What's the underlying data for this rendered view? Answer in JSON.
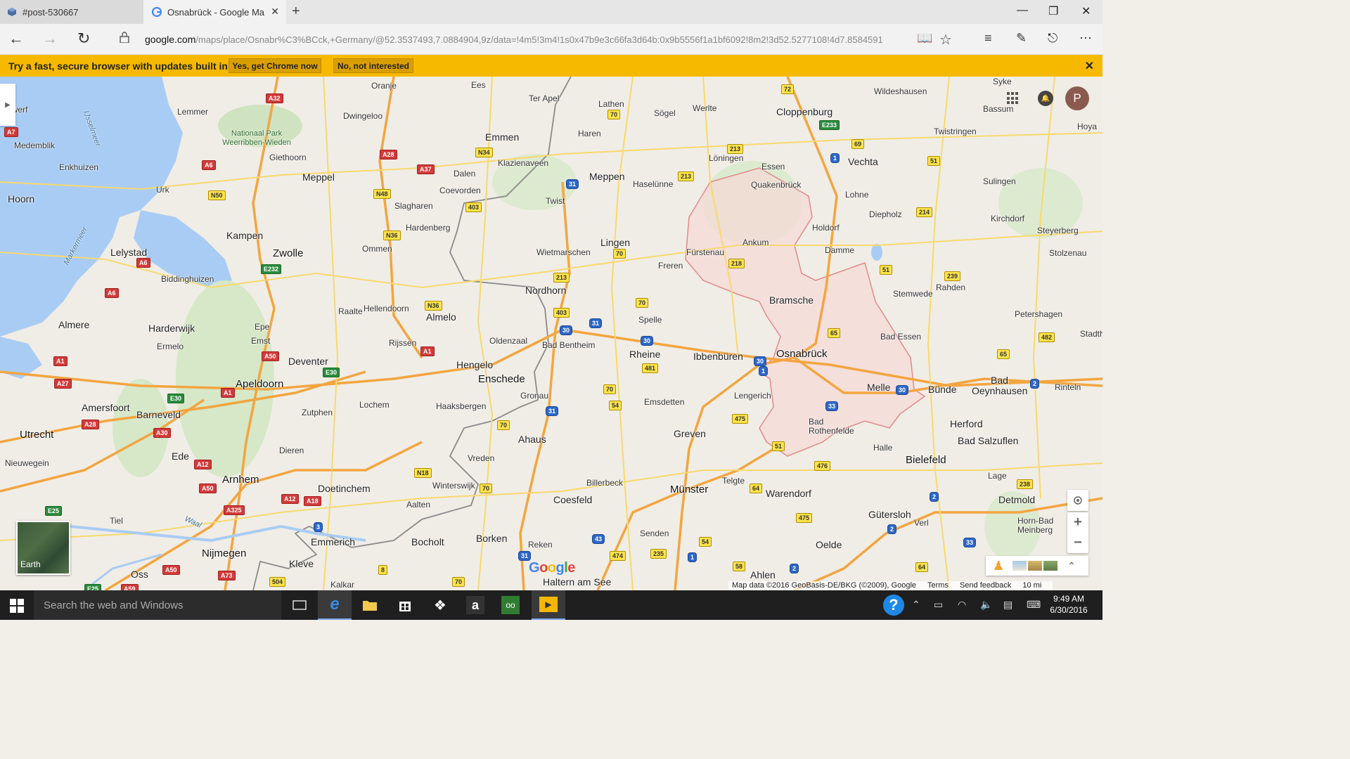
{
  "browser": {
    "tabs": [
      {
        "label": "#post-530667",
        "active": false
      },
      {
        "label": "Osnabrück - Google Ma",
        "active": true
      }
    ],
    "url_host": "google.com",
    "url_path": "/maps/place/Osnabr%C3%BCck,+Germany/@52.3537493,7.0884904,9z/data=!4m5!3m4!1s0x47b9e3c66fa3d64b:0x9b5556f1a1bf6092!8m2!3d52.5277108!4d7.8584591"
  },
  "promo": {
    "text": "Try a fast, secure browser with updates built in",
    "accept_label": "Yes, get Chrome now",
    "decline_label": "No, not interested"
  },
  "map": {
    "user_initial": "P",
    "earth_label": "Earth",
    "google_logo": "Google",
    "attribution": "Map data ©2016 GeoBasis-DE/BKG (©2009), Google",
    "terms": "Terms",
    "feedback": "Send feedback",
    "scale": "10 mi",
    "places": [
      {
        "name": "Oranje",
        "cls": "place"
      },
      {
        "name": "Ees",
        "cls": "place"
      },
      {
        "name": "Ter Apel",
        "cls": "place"
      },
      {
        "name": "Lathen",
        "cls": "place"
      },
      {
        "name": "Sögel",
        "cls": "place"
      },
      {
        "name": "Werlte",
        "cls": "place"
      },
      {
        "name": "Cloppenburg",
        "cls": "place big"
      },
      {
        "name": "Wildeshausen",
        "cls": "place"
      },
      {
        "name": "Syke",
        "cls": "place"
      },
      {
        "name": "Bassum",
        "cls": "place"
      },
      {
        "name": "erwerf",
        "cls": "place"
      },
      {
        "name": "Lemmer",
        "cls": "place"
      },
      {
        "name": "Dwingeloo",
        "cls": "place"
      },
      {
        "name": "Haren",
        "cls": "place"
      },
      {
        "name": "Emmen",
        "cls": "place big"
      },
      {
        "name": "Twistringen",
        "cls": "place"
      },
      {
        "name": "Hoya",
        "cls": "place"
      },
      {
        "name": "Medemblik",
        "cls": "place"
      },
      {
        "name": "Nationaal Park Weerribben-Wieden",
        "cls": "place park"
      },
      {
        "name": "Giethoorn",
        "cls": "place"
      },
      {
        "name": "Klazienaveen",
        "cls": "place"
      },
      {
        "name": "Löningen",
        "cls": "place"
      },
      {
        "name": "Vechta",
        "cls": "place big"
      },
      {
        "name": "Enkhuizen",
        "cls": "place"
      },
      {
        "name": "IJsselmeer",
        "cls": "place water"
      },
      {
        "name": "Meppel",
        "cls": "place big"
      },
      {
        "name": "Dalen",
        "cls": "place"
      },
      {
        "name": "Meppen",
        "cls": "place big"
      },
      {
        "name": "Haselünne",
        "cls": "place"
      },
      {
        "name": "Essen",
        "cls": "place"
      },
      {
        "name": "Quakenbrück",
        "cls": "place"
      },
      {
        "name": "Urk",
        "cls": "place"
      },
      {
        "name": "Coevorden",
        "cls": "place"
      },
      {
        "name": "Sulingen",
        "cls": "place"
      },
      {
        "name": "Hoorn",
        "cls": "place big"
      },
      {
        "name": "Lohne",
        "cls": "place"
      },
      {
        "name": "Twist",
        "cls": "place"
      },
      {
        "name": "Slagharen",
        "cls": "place"
      },
      {
        "name": "Diepholz",
        "cls": "place"
      },
      {
        "name": "Kirchdorf",
        "cls": "place"
      },
      {
        "name": "Hardenberg",
        "cls": "place"
      },
      {
        "name": "Holdorf",
        "cls": "place"
      },
      {
        "name": "Steyerberg",
        "cls": "place"
      },
      {
        "name": "Kampen",
        "cls": "place big"
      },
      {
        "name": "Markermeer",
        "cls": "place water"
      },
      {
        "name": "Zwolle",
        "cls": "place city"
      },
      {
        "name": "Lingen",
        "cls": "place big"
      },
      {
        "name": "Ankum",
        "cls": "place"
      },
      {
        "name": "Lelystad",
        "cls": "place big"
      },
      {
        "name": "Ommen",
        "cls": "place"
      },
      {
        "name": "Wietmarschen",
        "cls": "place"
      },
      {
        "name": "Fürstenau",
        "cls": "place"
      },
      {
        "name": "Damme",
        "cls": "place"
      },
      {
        "name": "Stolzenau",
        "cls": "place"
      },
      {
        "name": "Freren",
        "cls": "place"
      },
      {
        "name": "Rahden",
        "cls": "place"
      },
      {
        "name": "Biddinghuizen",
        "cls": "place"
      },
      {
        "name": "Nordhorn",
        "cls": "place big"
      },
      {
        "name": "Stemwede",
        "cls": "place"
      },
      {
        "name": "Bramsche",
        "cls": "place big"
      },
      {
        "name": "Raalte",
        "cls": "place"
      },
      {
        "name": "Hellendoorn",
        "cls": "place"
      },
      {
        "name": "Petershagen",
        "cls": "place"
      },
      {
        "name": "Almere",
        "cls": "place big"
      },
      {
        "name": "Almelo",
        "cls": "place big"
      },
      {
        "name": "Spelle",
        "cls": "place"
      },
      {
        "name": "Harderwijk",
        "cls": "place big"
      },
      {
        "name": "Epe",
        "cls": "place"
      },
      {
        "name": "Oldenzaal",
        "cls": "place"
      },
      {
        "name": "Bad Essen",
        "cls": "place"
      },
      {
        "name": "Stadth",
        "cls": "place"
      },
      {
        "name": "Bad Bentheim",
        "cls": "place"
      },
      {
        "name": "Rijssen",
        "cls": "place"
      },
      {
        "name": "Emst",
        "cls": "place"
      },
      {
        "name": "Ermelo",
        "cls": "place"
      },
      {
        "name": "Rheine",
        "cls": "place big"
      },
      {
        "name": "Osnabrück",
        "cls": "place city"
      },
      {
        "name": "Ibbenbüren",
        "cls": "place big"
      },
      {
        "name": "Deventer",
        "cls": "place big"
      },
      {
        "name": "Hengelo",
        "cls": "place big"
      },
      {
        "name": "Enschede",
        "cls": "place city"
      },
      {
        "name": "Bad",
        "cls": "place big"
      },
      {
        "name": "Apeldoorn",
        "cls": "place city"
      },
      {
        "name": "Melle",
        "cls": "place big"
      },
      {
        "name": "Bünde",
        "cls": "place big"
      },
      {
        "name": "Oeynhausen",
        "cls": "place big"
      },
      {
        "name": "Rinteln",
        "cls": "place"
      },
      {
        "name": "Lengerich",
        "cls": "place"
      },
      {
        "name": "Gronau",
        "cls": "place"
      },
      {
        "name": "Emsdetten",
        "cls": "place"
      },
      {
        "name": "Amersfoort",
        "cls": "place big"
      },
      {
        "name": "Lochem",
        "cls": "place"
      },
      {
        "name": "Haaksbergen",
        "cls": "place"
      },
      {
        "name": "Barneveld",
        "cls": "place big"
      },
      {
        "name": "Zutphen",
        "cls": "place"
      },
      {
        "name": "Herford",
        "cls": "place big"
      },
      {
        "name": "Bad Rothenfelde",
        "cls": "place"
      },
      {
        "name": "Utrecht",
        "cls": "place city"
      },
      {
        "name": "Greven",
        "cls": "place big"
      },
      {
        "name": "Ahaus",
        "cls": "place big"
      },
      {
        "name": "Bad Salzuflen",
        "cls": "place big"
      },
      {
        "name": "Halle",
        "cls": "place"
      },
      {
        "name": "Dieren",
        "cls": "place"
      },
      {
        "name": "Bielefeld",
        "cls": "place city"
      },
      {
        "name": "Vreden",
        "cls": "place"
      },
      {
        "name": "Ede",
        "cls": "place big"
      },
      {
        "name": "Nieuwegein",
        "cls": "place"
      },
      {
        "name": "Lage",
        "cls": "place"
      },
      {
        "name": "Arnhem",
        "cls": "place city"
      },
      {
        "name": "Telgte",
        "cls": "place"
      },
      {
        "name": "Billerbeck",
        "cls": "place"
      },
      {
        "name": "Doetinchem",
        "cls": "place big"
      },
      {
        "name": "Winterswijk",
        "cls": "place"
      },
      {
        "name": "Münster",
        "cls": "place city"
      },
      {
        "name": "Warendorf",
        "cls": "place big"
      },
      {
        "name": "Detmold",
        "cls": "place big"
      },
      {
        "name": "Coesfeld",
        "cls": "place big"
      },
      {
        "name": "Aalten",
        "cls": "place"
      },
      {
        "name": "Tiel",
        "cls": "place"
      },
      {
        "name": "Gütersloh",
        "cls": "place big"
      },
      {
        "name": "Horn-Bad Meinberg",
        "cls": "place"
      },
      {
        "name": "Verl",
        "cls": "place"
      },
      {
        "name": "Waal",
        "cls": "place water"
      },
      {
        "name": "Emmerich",
        "cls": "place big"
      },
      {
        "name": "Bocholt",
        "cls": "place big"
      },
      {
        "name": "Borken",
        "cls": "place big"
      },
      {
        "name": "Senden",
        "cls": "place"
      },
      {
        "name": "Oelde",
        "cls": "place big"
      },
      {
        "name": "Nijmegen",
        "cls": "place city"
      },
      {
        "name": "Kleve",
        "cls": "place big"
      },
      {
        "name": "Reken",
        "cls": "place"
      },
      {
        "name": "Ahlen",
        "cls": "place big"
      },
      {
        "name": "Oss",
        "cls": "place big"
      },
      {
        "name": "Kalkar",
        "cls": "place"
      },
      {
        "name": "Haltern am See",
        "cls": "place big"
      }
    ],
    "shields": [
      {
        "label": "A7",
        "cls": "shield red"
      },
      {
        "label": "A32",
        "cls": "shield red"
      },
      {
        "label": "72",
        "cls": "shield"
      },
      {
        "label": "70",
        "cls": "shield"
      },
      {
        "label": "A6",
        "cls": "shield red"
      },
      {
        "label": "A28",
        "cls": "shield red"
      },
      {
        "label": "N34",
        "cls": "shield"
      },
      {
        "label": "213",
        "cls": "shield"
      },
      {
        "label": "E233",
        "cls": "shield green"
      },
      {
        "label": "69",
        "cls": "shield"
      },
      {
        "label": "1",
        "cls": "shield blue"
      },
      {
        "label": "A37",
        "cls": "shield red"
      },
      {
        "label": "51",
        "cls": "shield"
      },
      {
        "label": "31",
        "cls": "shield blue"
      },
      {
        "label": "213",
        "cls": "shield"
      },
      {
        "label": "N50",
        "cls": "shield"
      },
      {
        "label": "N48",
        "cls": "shield"
      },
      {
        "label": "403",
        "cls": "shield"
      },
      {
        "label": "214",
        "cls": "shield"
      },
      {
        "label": "N36",
        "cls": "shield"
      },
      {
        "label": "70",
        "cls": "shield"
      },
      {
        "label": "218",
        "cls": "shield"
      },
      {
        "label": "A6",
        "cls": "shield red"
      },
      {
        "label": "51",
        "cls": "shield"
      },
      {
        "label": "E232",
        "cls": "shield green"
      },
      {
        "label": "213",
        "cls": "shield"
      },
      {
        "label": "239",
        "cls": "shield"
      },
      {
        "label": "A6",
        "cls": "shield red"
      },
      {
        "label": "N36",
        "cls": "shield"
      },
      {
        "label": "70",
        "cls": "shield"
      },
      {
        "label": "403",
        "cls": "shield"
      },
      {
        "label": "31",
        "cls": "shield blue"
      },
      {
        "label": "30",
        "cls": "shield blue"
      },
      {
        "label": "65",
        "cls": "shield"
      },
      {
        "label": "A50",
        "cls": "shield red"
      },
      {
        "label": "A1",
        "cls": "shield red"
      },
      {
        "label": "30",
        "cls": "shield blue"
      },
      {
        "label": "482",
        "cls": "shield"
      },
      {
        "label": "A1",
        "cls": "shield red"
      },
      {
        "label": "E30",
        "cls": "shield green"
      },
      {
        "label": "481",
        "cls": "shield"
      },
      {
        "label": "30",
        "cls": "shield blue"
      },
      {
        "label": "1",
        "cls": "shield blue"
      },
      {
        "label": "65",
        "cls": "shield"
      },
      {
        "label": "A27",
        "cls": "shield red"
      },
      {
        "label": "A1",
        "cls": "shield red"
      },
      {
        "label": "70",
        "cls": "shield"
      },
      {
        "label": "30",
        "cls": "shield blue"
      },
      {
        "label": "2",
        "cls": "shield blue"
      },
      {
        "label": "E30",
        "cls": "shield green"
      },
      {
        "label": "54",
        "cls": "shield"
      },
      {
        "label": "33",
        "cls": "shield blue"
      },
      {
        "label": "31",
        "cls": "shield blue"
      },
      {
        "label": "A28",
        "cls": "shield red"
      },
      {
        "label": "475",
        "cls": "shield"
      },
      {
        "label": "A30",
        "cls": "shield red"
      },
      {
        "label": "70",
        "cls": "shield"
      },
      {
        "label": "51",
        "cls": "shield"
      },
      {
        "label": "A12",
        "cls": "shield red"
      },
      {
        "label": "476",
        "cls": "shield"
      },
      {
        "label": "N18",
        "cls": "shield"
      },
      {
        "label": "238",
        "cls": "shield"
      },
      {
        "label": "A50",
        "cls": "shield red"
      },
      {
        "label": "70",
        "cls": "shield"
      },
      {
        "label": "64",
        "cls": "shield"
      },
      {
        "label": "2",
        "cls": "shield blue"
      },
      {
        "label": "A12",
        "cls": "shield red"
      },
      {
        "label": "A18",
        "cls": "shield red"
      },
      {
        "label": "E25",
        "cls": "shield green"
      },
      {
        "label": "A325",
        "cls": "shield red"
      },
      {
        "label": "475",
        "cls": "shield"
      },
      {
        "label": "3",
        "cls": "shield blue"
      },
      {
        "label": "2",
        "cls": "shield blue"
      },
      {
        "label": "43",
        "cls": "shield blue"
      },
      {
        "label": "54",
        "cls": "shield"
      },
      {
        "label": "33",
        "cls": "shield blue"
      },
      {
        "label": "235",
        "cls": "shield"
      },
      {
        "label": "A50",
        "cls": "shield red"
      },
      {
        "label": "474",
        "cls": "shield"
      },
      {
        "label": "31",
        "cls": "shield blue"
      },
      {
        "label": "1",
        "cls": "shield blue"
      },
      {
        "label": "58",
        "cls": "shield"
      },
      {
        "label": "2",
        "cls": "shield blue"
      },
      {
        "label": "64",
        "cls": "shield"
      },
      {
        "label": "8",
        "cls": "shield"
      },
      {
        "label": "A73",
        "cls": "shield red"
      },
      {
        "label": "504",
        "cls": "shield"
      },
      {
        "label": "70",
        "cls": "shield"
      },
      {
        "label": "A59",
        "cls": "shield red"
      },
      {
        "label": "E25",
        "cls": "shield green"
      }
    ]
  },
  "taskbar": {
    "search_placeholder": "Search the web and Windows",
    "time": "9:49 AM",
    "date": "6/30/2016"
  }
}
